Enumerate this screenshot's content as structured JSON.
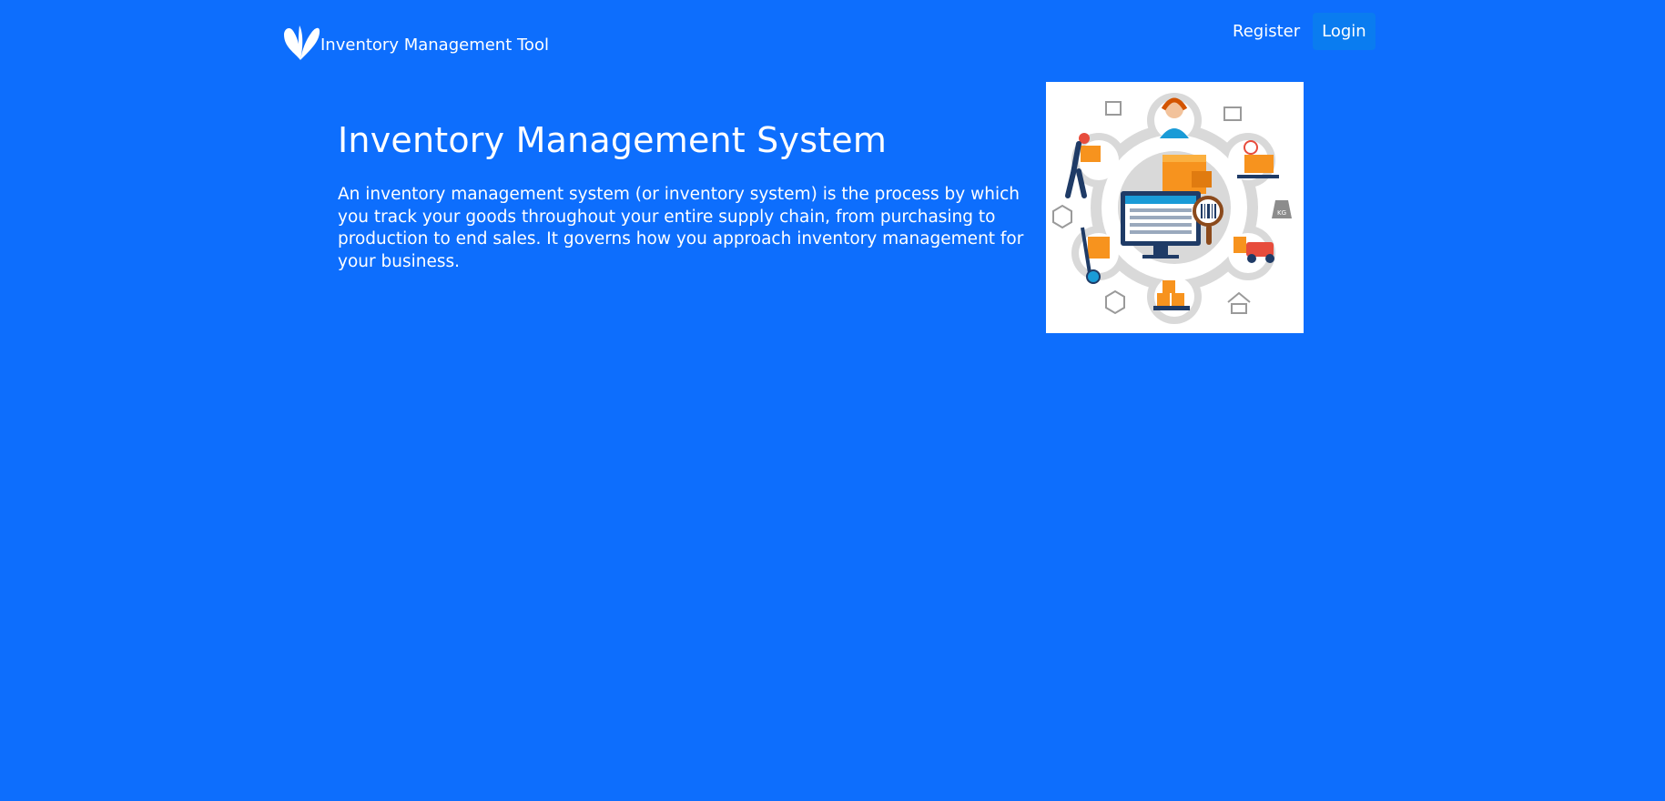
{
  "header": {
    "brand_name": "Inventory Management Tool",
    "brand_icon": "leaf-icon",
    "nav": [
      {
        "label": "Register",
        "active": false
      },
      {
        "label": "Login",
        "active": true
      }
    ]
  },
  "main": {
    "title": "Inventory Management System",
    "description": "An inventory management system (or inventory system) is the process by which you track your goods throughout your entire supply chain, from purchasing to production to end sales. It governs how you approach inventory management for your business.",
    "illustration": {
      "icon": "inventory-illustration",
      "weight_label": "KG"
    }
  },
  "colors": {
    "background": "#0d6efd",
    "active_nav": "#0a7cf0",
    "accent_orange": "#f7931e",
    "accent_navy": "#1f3b66"
  }
}
